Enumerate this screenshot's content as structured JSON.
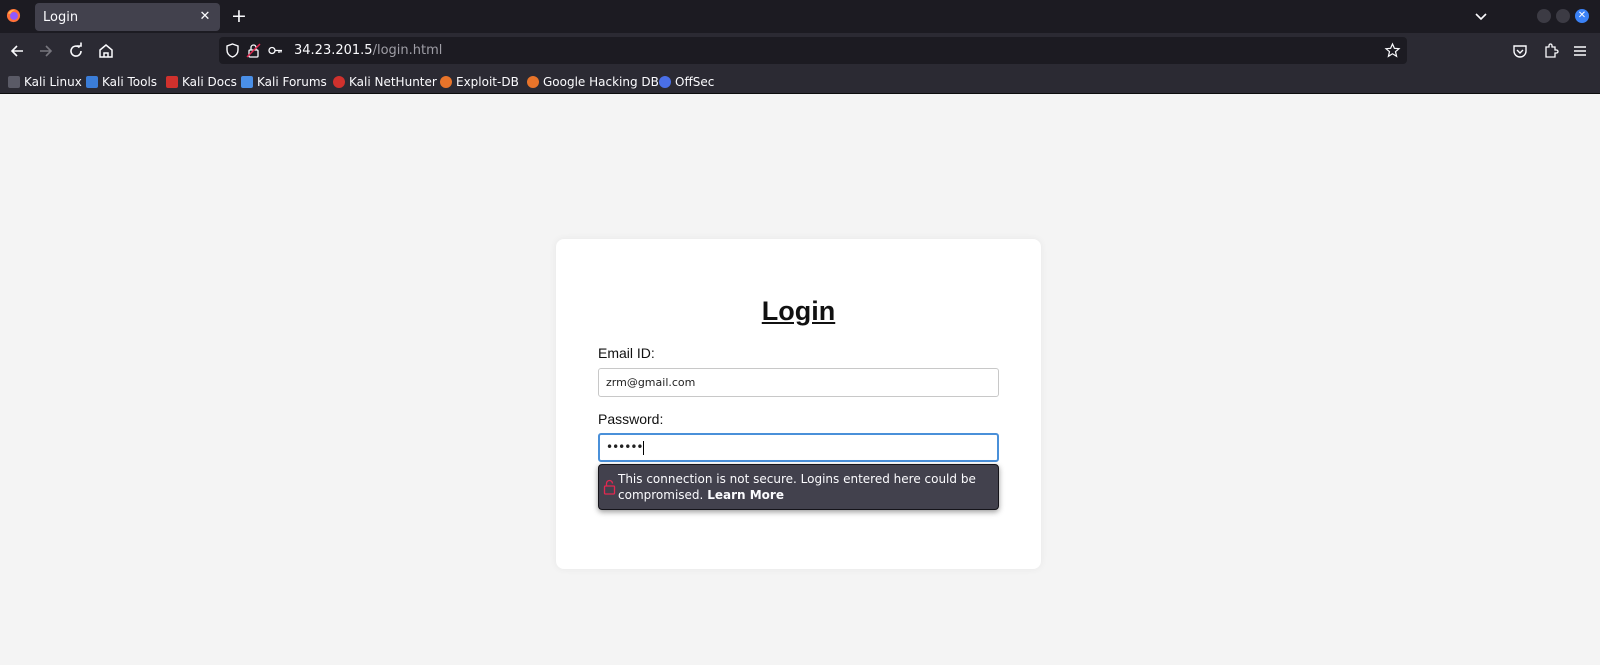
{
  "browser": {
    "tab": {
      "title": "Login"
    },
    "url": {
      "host": "34.23.201.5",
      "path": "/login.html"
    },
    "bookmarks": [
      {
        "label": "Kali Linux",
        "icon": "kali-dragon-icon",
        "color": "#367bf0"
      },
      {
        "label": "Kali Tools",
        "icon": "kali-tools-icon",
        "color": "#3b7dd8"
      },
      {
        "label": "Kali Docs",
        "icon": "kali-docs-icon",
        "color": "#d0312d"
      },
      {
        "label": "Kali Forums",
        "icon": "kali-forums-icon",
        "color": "#4a8fe7"
      },
      {
        "label": "Kali NetHunter",
        "icon": "nethunter-icon",
        "color": "#d0312d"
      },
      {
        "label": "Exploit-DB",
        "icon": "exploit-db-icon",
        "color": "#e8742a"
      },
      {
        "label": "Google Hacking DB",
        "icon": "ghdb-icon",
        "color": "#e8742a"
      },
      {
        "label": "OffSec",
        "icon": "offsec-icon",
        "color": "#4a6fe7"
      }
    ]
  },
  "page": {
    "heading": "Login",
    "email_label": "Email ID:",
    "email_value": "zrm@gmail.com",
    "password_label": "Password:",
    "password_value": "••••••"
  },
  "insecure_warning": {
    "text": "This connection is not secure. Logins entered here could be compromised.",
    "link": "Learn More"
  },
  "colors": {
    "accent_button": "#28a745",
    "focus_ring": "#4a90d9",
    "warning_icon": "#e22850"
  }
}
